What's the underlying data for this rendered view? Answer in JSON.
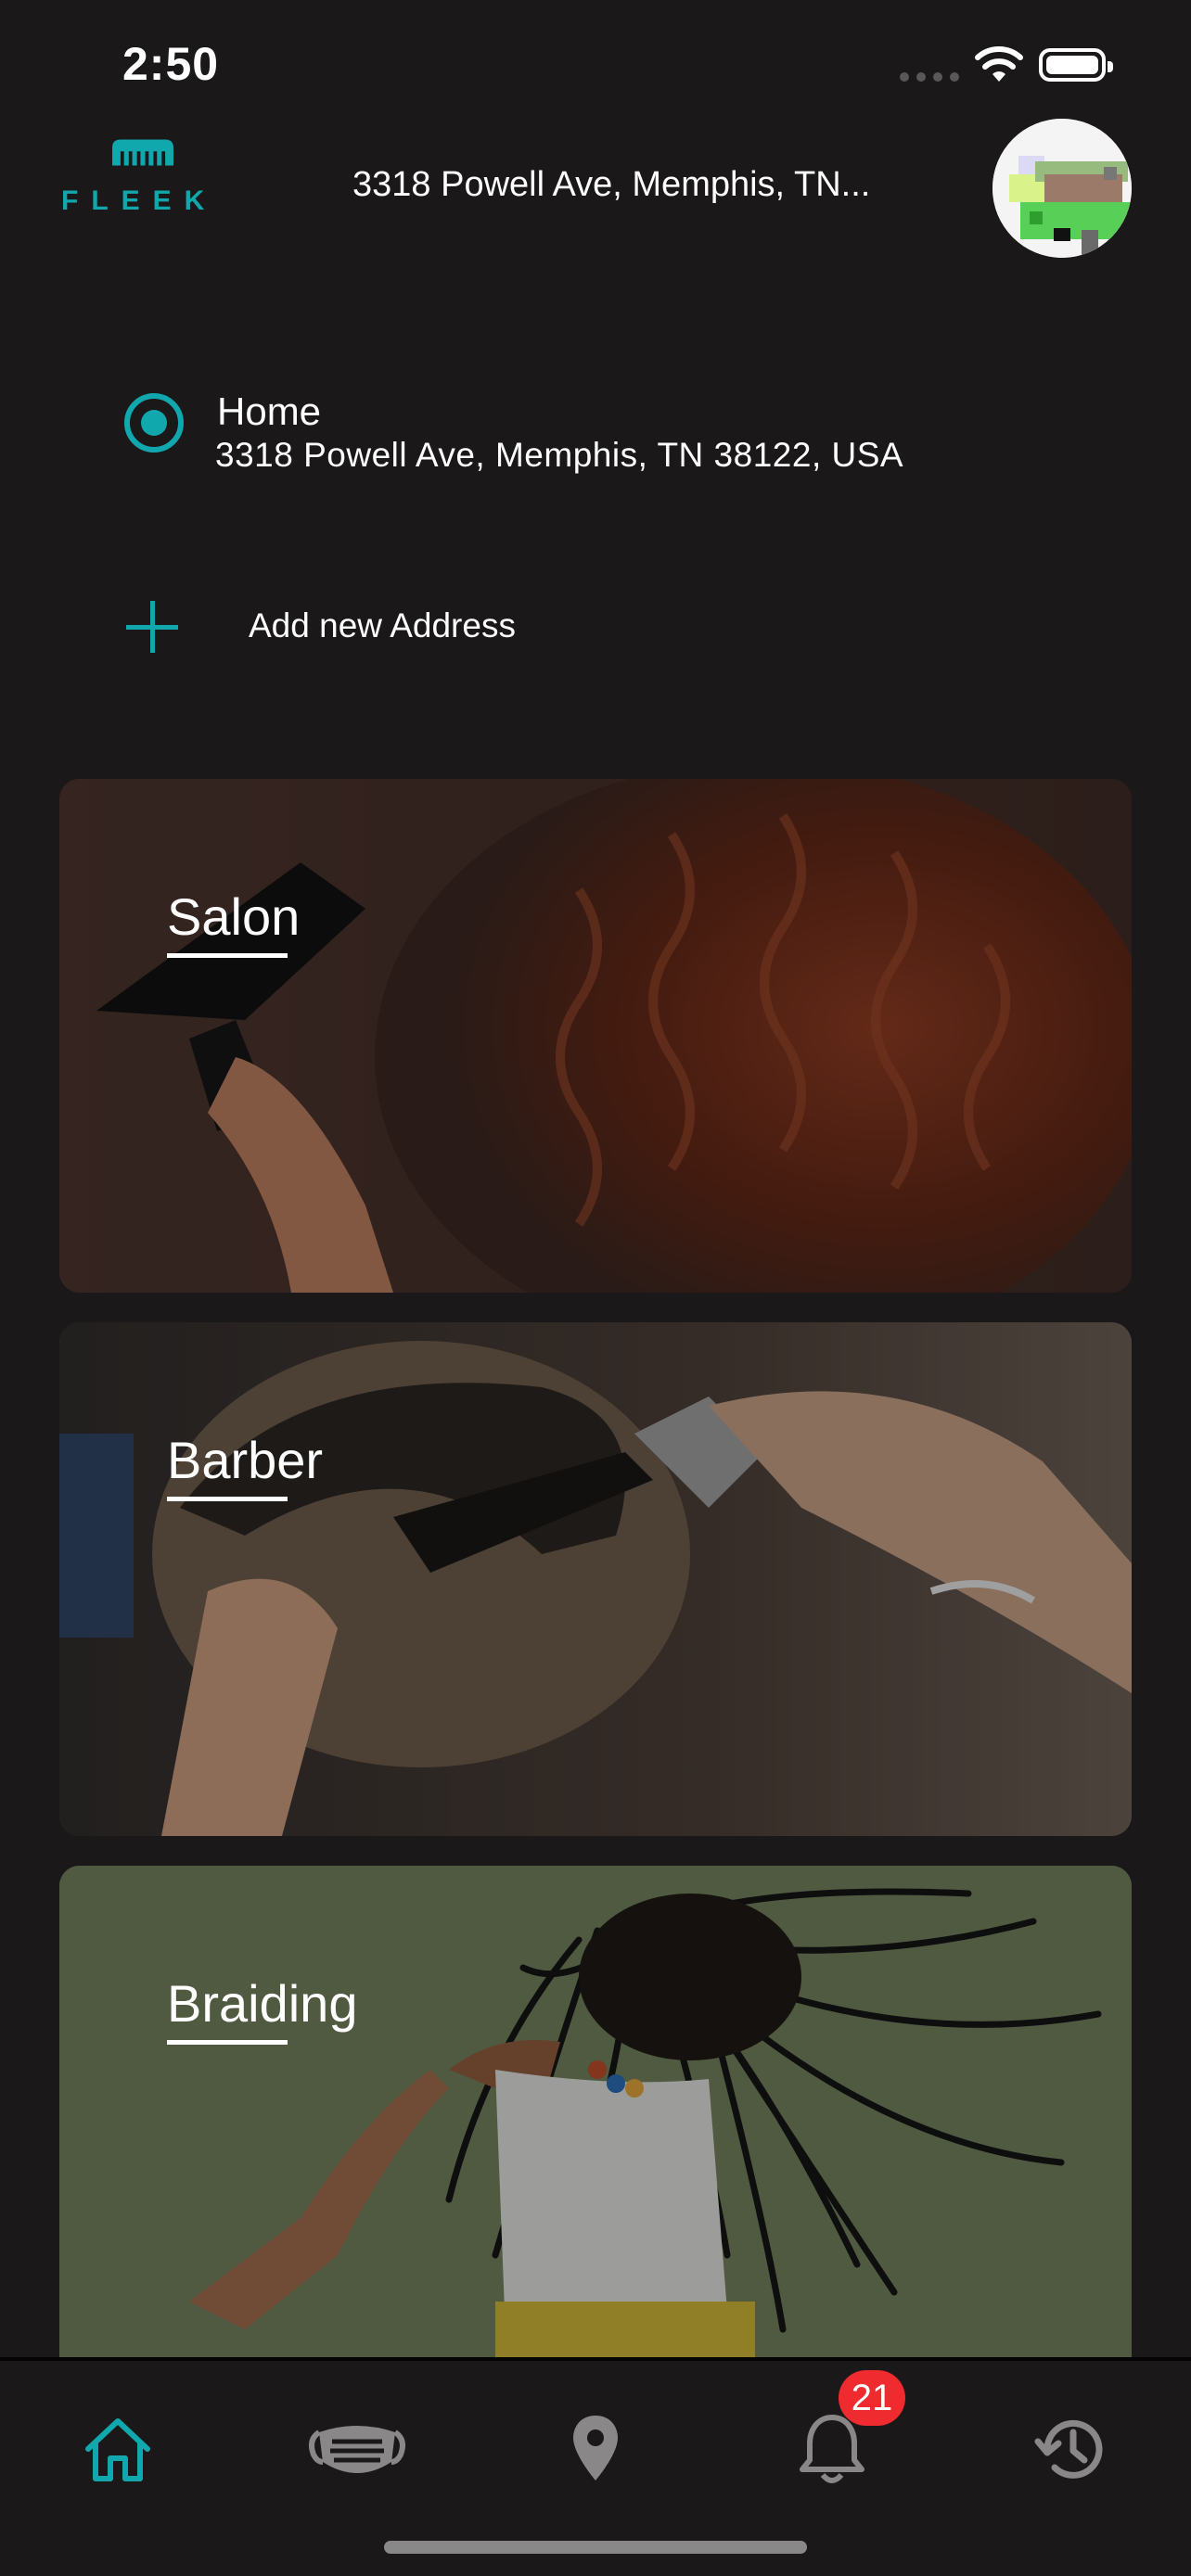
{
  "status_bar": {
    "time": "2:50"
  },
  "header": {
    "logo_text": "FLEEK",
    "current_address": "3318 Powell Ave, Memphis, TN..."
  },
  "addresses": {
    "saved": [
      {
        "label": "Home",
        "address": "3318 Powell Ave, Memphis, TN 38122, USA",
        "selected": true
      }
    ],
    "add_label": "Add new Address"
  },
  "categories": [
    {
      "title": "Salon"
    },
    {
      "title": "Barber"
    },
    {
      "title": "Braiding"
    }
  ],
  "tab_bar": {
    "items": [
      {
        "icon": "home-icon",
        "active": true
      },
      {
        "icon": "mask-icon",
        "active": false
      },
      {
        "icon": "location-pin-icon",
        "active": false
      },
      {
        "icon": "bell-icon",
        "active": false,
        "badge": "21"
      },
      {
        "icon": "history-icon",
        "active": false
      }
    ]
  },
  "colors": {
    "accent": "#11a8ad",
    "background": "#1b1819",
    "badge": "#ef2b2f"
  }
}
